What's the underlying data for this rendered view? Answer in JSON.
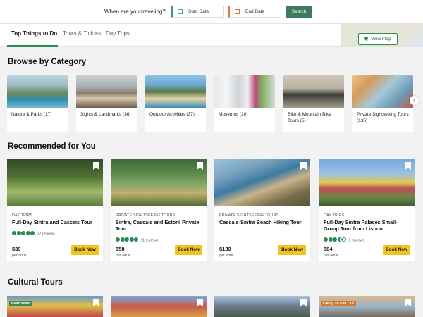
{
  "search": {
    "question": "When are you traveling?",
    "start_date": "Start Date",
    "end_date": "End Date",
    "search_button": "Search"
  },
  "tabs": [
    {
      "label": "Top Things to Do",
      "active": true
    },
    {
      "label": "Tours & Tickets",
      "active": false
    },
    {
      "label": "Day Trips",
      "active": false
    }
  ],
  "map": {
    "view_map_label": "View map"
  },
  "browse": {
    "title": "Browse by Category",
    "categories": [
      {
        "label": "Nature & Parks (17)"
      },
      {
        "label": "Sights & Landmarks (36)"
      },
      {
        "label": "Outdoor Activities (37)"
      },
      {
        "label": "Museums (10)"
      },
      {
        "label": "Bike & Mountain Bike Tours (5)"
      },
      {
        "label": "Private Sightseeing Tours (135)"
      }
    ]
  },
  "recommended": {
    "title": "Recommended for You",
    "cards": [
      {
        "category": "DAY TRIPS",
        "title": "Full-Day Sintra and Cascais Tour",
        "rating": 5,
        "reviews": "77 reviews",
        "price": "$39",
        "per": "per adult",
        "book": "Book Now"
      },
      {
        "category": "PRIVATE SIGHTSEEING TOURS",
        "title": "Sintra, Cascais and Estoril Private Tour",
        "rating": 5,
        "reviews": "11 reviews",
        "price": "$58",
        "per": "per adult",
        "book": "Book Now"
      },
      {
        "category": "PRIVATE SIGHTSEEING TOURS",
        "title": "Cascais-Sintra Beach Hiking Tour",
        "rating": null,
        "reviews": "",
        "price": "$139",
        "per": "per adult",
        "book": "Book Now"
      },
      {
        "category": "DAY TRIPS",
        "title": "Full-Day Sintra Palaces Small-Group Tour from Lisbon",
        "rating": 3.5,
        "reviews": "3 reviews",
        "price": "$84",
        "per": "per adult",
        "book": "Book Now"
      }
    ]
  },
  "cultural": {
    "title": "Cultural Tours",
    "badges": [
      "Best Seller",
      "",
      "",
      "Likely To Sell Out"
    ]
  }
}
